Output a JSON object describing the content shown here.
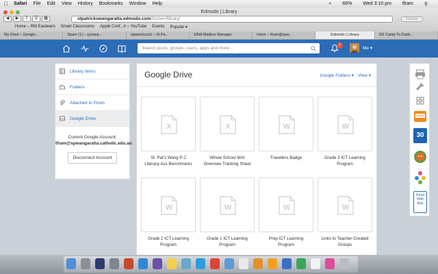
{
  "menubar": {
    "app": "Safari",
    "items": [
      "File",
      "Edit",
      "View",
      "History",
      "Bookmarks",
      "Window",
      "Help"
    ],
    "battery": "66%",
    "clock": "Wed 3:10 pm",
    "user": "tfram"
  },
  "browser": {
    "window_title": "Edmodo | Library",
    "url_host": "stpatrickswangaratta.edmodo.com",
    "url_path": "/home#/library/",
    "reader_label": "Reader",
    "bookmarks": [
      "Home – RM Easilearn",
      "Smart Classrooms",
      "Apple Conf...h – YouTube",
      "Events",
      "Popular ▾"
    ],
    "tabs": [
      {
        "label": "My Drive – Google...",
        "active": false
      },
      {
        "label": "Spam (1) – syrianp...",
        "active": false
      },
      {
        "label": "stpatrickscict – St Pa...",
        "active": false
      },
      {
        "label": "SINA Mailbox Manager",
        "active": false
      },
      {
        "label": "Inbox – tfram@spw...",
        "active": false
      },
      {
        "label": "Edmodo | Library",
        "active": true
      },
      {
        "label": "5/6 Camp To Canb...",
        "active": false
      }
    ]
  },
  "topbar": {
    "search_placeholder": "Search posts, groups, users, apps and more...",
    "notification_count": "2",
    "me_label": "Me ▾",
    "brand_color": "#2b6cb6"
  },
  "sidebar": {
    "items": [
      {
        "label": "Library Items",
        "icon": "grid-icon",
        "active": false
      },
      {
        "label": "Folders",
        "icon": "folders-icon",
        "active": false
      },
      {
        "label": "Attached to Posts",
        "icon": "paperclip-icon",
        "active": false
      },
      {
        "label": "Google Drive",
        "icon": "drive-icon",
        "active": true
      }
    ],
    "account_heading": "Current Google Account:",
    "account_email": "tfram@spwangaratta.catholic.edu.au",
    "disconnect_label": "Disconnect Account"
  },
  "main": {
    "title": "Google Drive",
    "folders_label": "Google Folders ▾",
    "view_label": "View ▾",
    "files": [
      {
        "name": "St. Pat's Wang P-2 Literacy Ass Benchmarks",
        "kind": "X"
      },
      {
        "name": "Whole School MAI Overview Tracking Sheet",
        "kind": "X"
      },
      {
        "name": "Travellers Badge",
        "kind": "W"
      },
      {
        "name": "Grade 3 ICT Learning Program",
        "kind": "W"
      },
      {
        "name": "Grade 2 ICT Learning Program",
        "kind": "W"
      },
      {
        "name": "Grade 1 ICT Learning Program",
        "kind": "W"
      },
      {
        "name": "Prep ICT Learning Program",
        "kind": "W"
      },
      {
        "name": "Links to Teacher-Created Groups",
        "kind": "W"
      }
    ]
  },
  "right_tools": {
    "calendar_day": "30",
    "readwrite_label": "Read With App"
  }
}
